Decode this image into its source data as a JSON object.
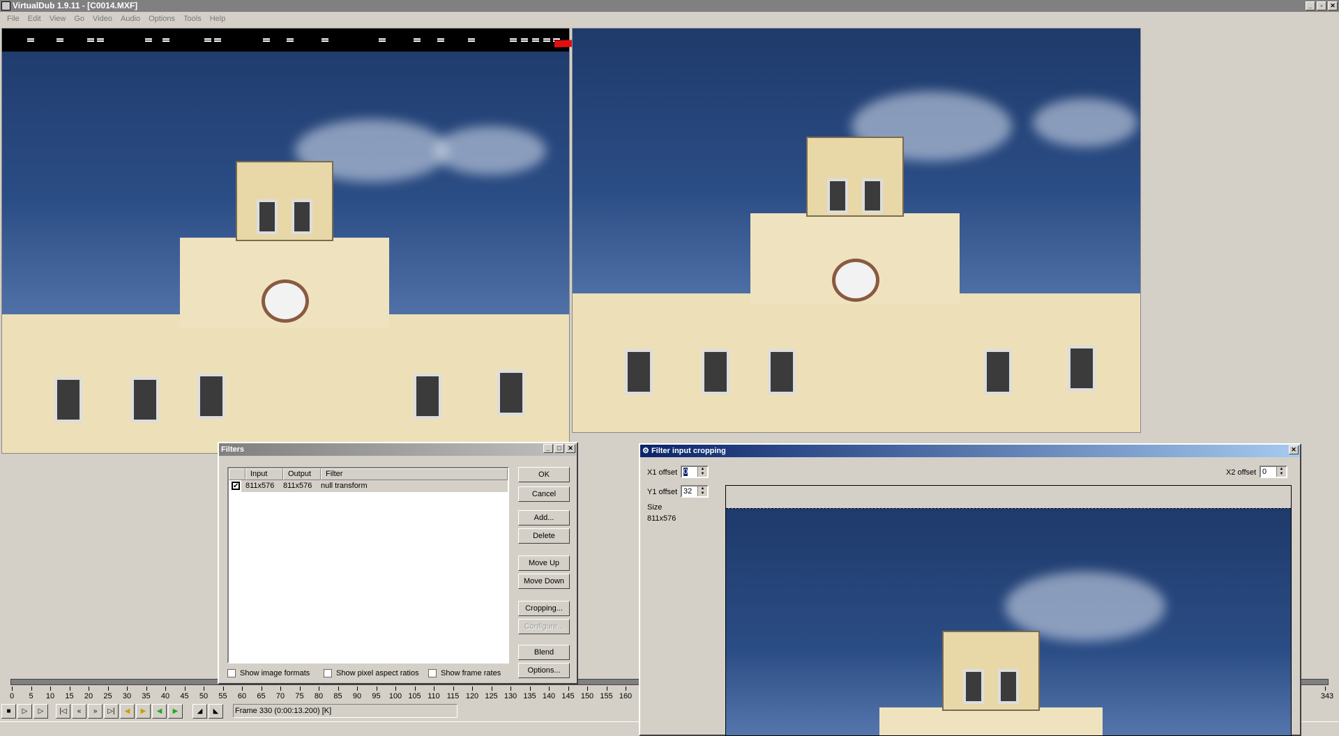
{
  "window": {
    "title": "VirtualDub 1.9.11 - [C0014.MXF]"
  },
  "menu": [
    "File",
    "Edit",
    "View",
    "Go",
    "Video",
    "Audio",
    "Options",
    "Tools",
    "Help"
  ],
  "filters_dialog": {
    "title": "Filters",
    "columns": [
      "Input",
      "Output",
      "Filter"
    ],
    "rows": [
      {
        "checked": true,
        "input": "811x576",
        "output": "811x576",
        "filter": "null transform"
      }
    ],
    "buttons": {
      "ok": "OK",
      "cancel": "Cancel",
      "add": "Add...",
      "delete": "Delete",
      "move_up": "Move Up",
      "move_down": "Move Down",
      "cropping": "Cropping...",
      "configure": "Configure...",
      "blend": "Blend",
      "options": "Options..."
    },
    "checkboxes": [
      {
        "label": "Show image formats",
        "checked": false
      },
      {
        "label": "Show pixel aspect ratios",
        "checked": false
      },
      {
        "label": "Show frame rates",
        "checked": false
      }
    ]
  },
  "crop_dialog": {
    "title": "Filter input cropping",
    "x1_label": "X1 offset",
    "x1_value": "0",
    "y1_label": "Y1 offset",
    "y1_value": "32",
    "x2_label": "X2 offset",
    "x2_value": "0",
    "size_label": "Size",
    "size_value": "811x576"
  },
  "timeline": {
    "ticks": [
      "0",
      "5",
      "10",
      "15",
      "20",
      "25",
      "30",
      "35",
      "40",
      "45",
      "50",
      "55",
      "60",
      "65",
      "70",
      "75",
      "80",
      "85",
      "90",
      "95",
      "100",
      "105",
      "110",
      "115",
      "120",
      "125",
      "130",
      "135",
      "140",
      "145",
      "150",
      "155",
      "160"
    ],
    "end_label": "343"
  },
  "status": {
    "frame_text": "Frame 330 (0:00:13.200) [K]"
  },
  "colors": {
    "arrow": "#e01010",
    "crop_title_start": "#0a246a",
    "crop_title_end": "#a6caf0"
  }
}
